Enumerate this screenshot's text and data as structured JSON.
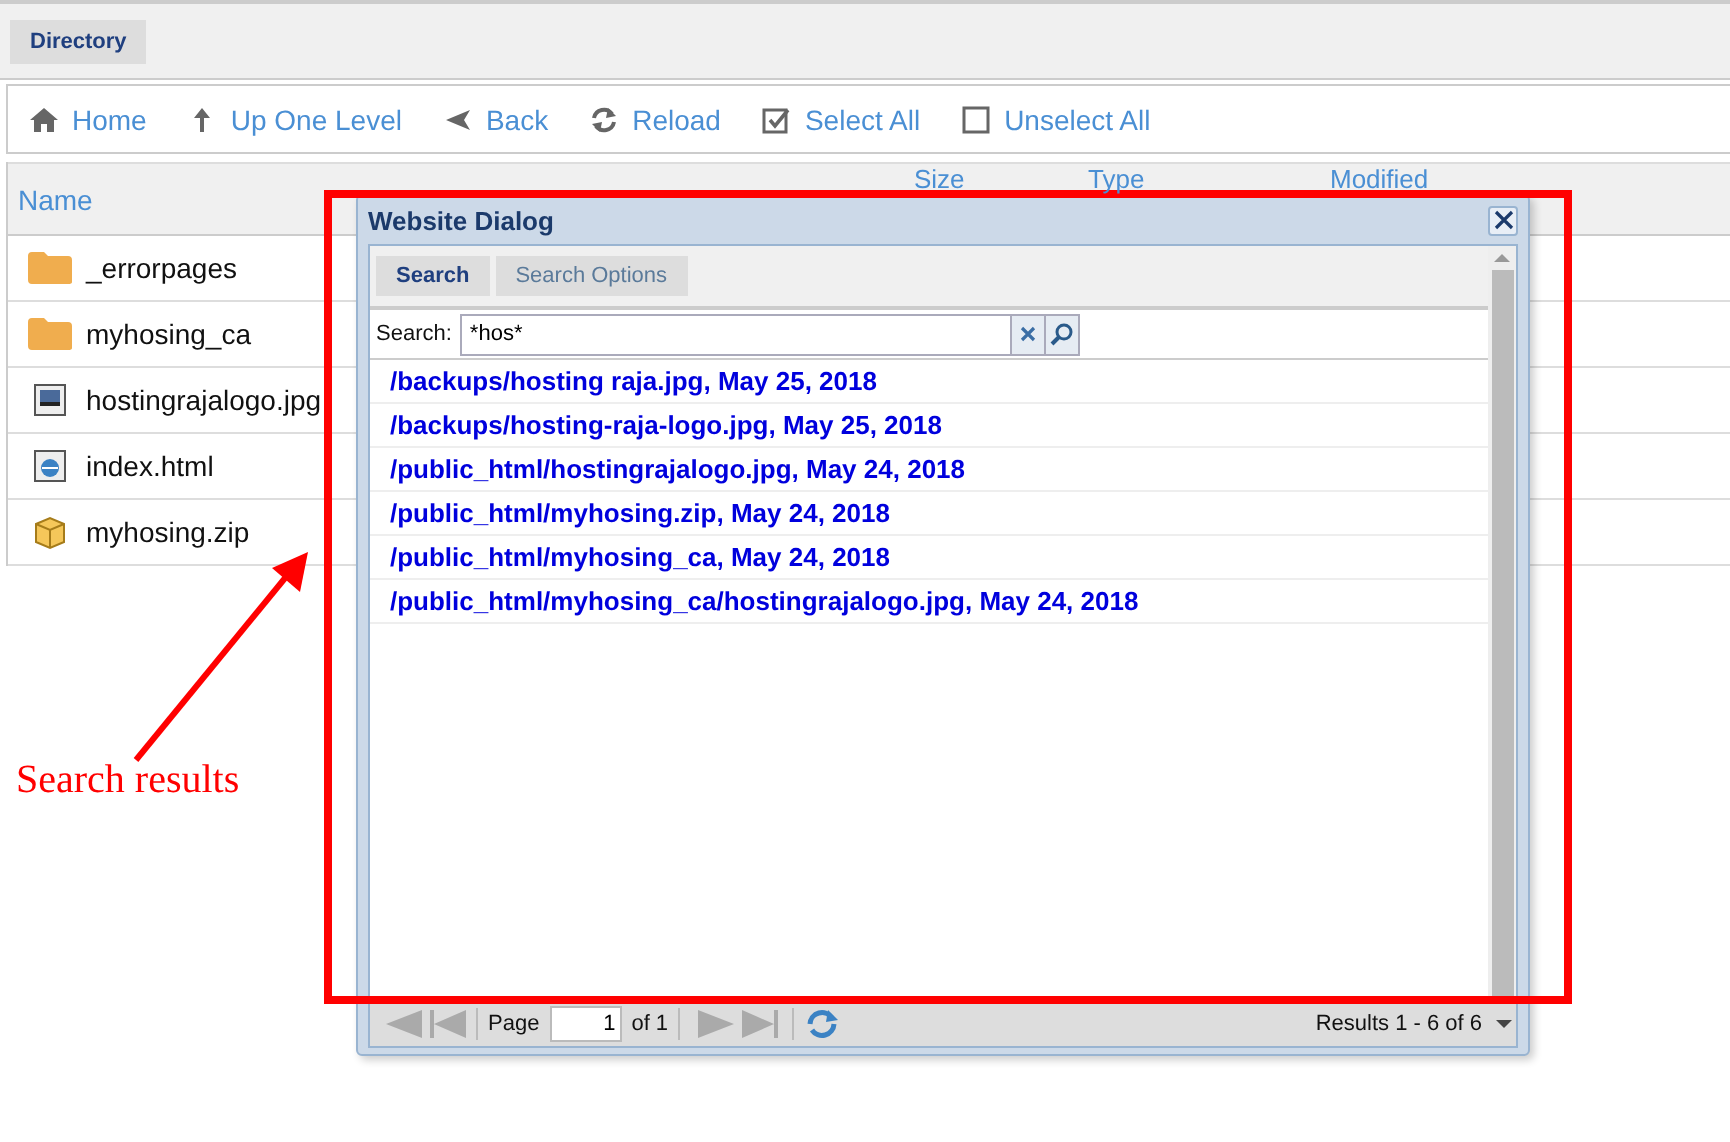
{
  "top_tabs": [
    {
      "label": "Directory",
      "selected": true
    }
  ],
  "toolbar": [
    {
      "kind": "home",
      "label": "Home"
    },
    {
      "kind": "up",
      "label": "Up One Level"
    },
    {
      "kind": "back",
      "label": "Back"
    },
    {
      "kind": "reload",
      "label": "Reload"
    },
    {
      "kind": "select",
      "label": "Select All"
    },
    {
      "kind": "unselect",
      "label": "Unselect All"
    }
  ],
  "table": {
    "columns": [
      "Name",
      "Size",
      "Type",
      "Modified"
    ],
    "rows": [
      {
        "kind": "folder",
        "name": "_errorpages"
      },
      {
        "kind": "folder",
        "name": "myhosing_ca"
      },
      {
        "kind": "image",
        "name": "hostingrajalogo.jpg"
      },
      {
        "kind": "html",
        "name": "index.html"
      },
      {
        "kind": "zip",
        "name": "myhosing.zip"
      }
    ]
  },
  "dialog": {
    "title": "Website Dialog",
    "tabs": [
      {
        "label": "Search",
        "selected": true
      },
      {
        "label": "Search Options",
        "selected": false
      }
    ],
    "search": {
      "label": "Search:",
      "value": "*hos*"
    },
    "results": [
      "/backups/hosting raja.jpg, May 25, 2018",
      "/backups/hosting-raja-logo.jpg, May 25, 2018",
      "/public_html/hostingrajalogo.jpg, May 24, 2018",
      "/public_html/myhosing.zip, May 24, 2018",
      "/public_html/myhosing_ca, May 24, 2018",
      "/public_html/myhosing_ca/hostingrajalogo.jpg, May 24, 2018"
    ],
    "pager": {
      "page_label": "Page",
      "page": "1",
      "of": "of 1",
      "results": "Results 1 - 6 of 6"
    }
  },
  "annotation": {
    "label": "Search results"
  }
}
